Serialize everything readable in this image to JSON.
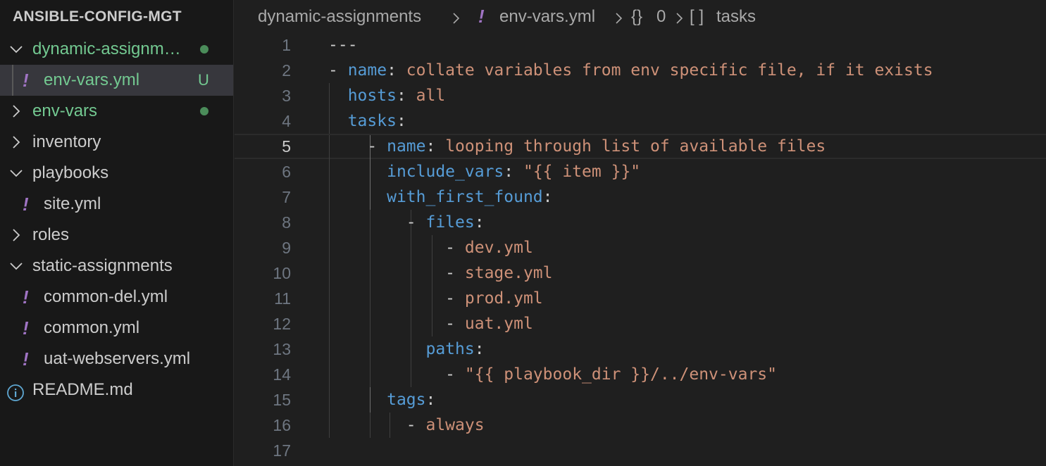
{
  "explorer": {
    "title": "ANSIBLE-CONFIG-MGT",
    "items": [
      {
        "label": "dynamic-assignments",
        "kind": "folder-open",
        "badge": "dot"
      },
      {
        "label": "env-vars.yml",
        "kind": "yaml-file",
        "badge": "U",
        "selected": true
      },
      {
        "label": "env-vars",
        "kind": "folder-closed",
        "badge": "dot"
      },
      {
        "label": "inventory",
        "kind": "folder-closed"
      },
      {
        "label": "playbooks",
        "kind": "folder-open"
      },
      {
        "label": "site.yml",
        "kind": "yaml-file"
      },
      {
        "label": "roles",
        "kind": "folder-closed"
      },
      {
        "label": "static-assignments",
        "kind": "folder-open"
      },
      {
        "label": "common-del.yml",
        "kind": "yaml-file"
      },
      {
        "label": "common.yml",
        "kind": "yaml-file"
      },
      {
        "label": "uat-webservers.yml",
        "kind": "yaml-file"
      },
      {
        "label": "README.md",
        "kind": "info-file"
      }
    ]
  },
  "breadcrumb": {
    "folder": "dynamic-assignments",
    "file_icon": "!",
    "file": "env-vars.yml",
    "obj_icon": "{}",
    "obj": "0",
    "arr_icon": "[ ]",
    "arr": "tasks"
  },
  "editor": {
    "current_line": 5,
    "lines": [
      {
        "n": "1",
        "parts": [
          [
            "punc",
            "---"
          ]
        ]
      },
      {
        "n": "2",
        "parts": [
          [
            "punc",
            "- "
          ],
          [
            "key",
            "name"
          ],
          [
            "punc",
            ": "
          ],
          [
            "str",
            "collate variables from env specific file, if it exists"
          ]
        ]
      },
      {
        "n": "3",
        "parts": [
          [
            "punc",
            "  "
          ],
          [
            "key",
            "hosts"
          ],
          [
            "punc",
            ": "
          ],
          [
            "str",
            "all"
          ]
        ]
      },
      {
        "n": "4",
        "parts": [
          [
            "punc",
            "  "
          ],
          [
            "key",
            "tasks"
          ],
          [
            "punc",
            ":"
          ]
        ]
      },
      {
        "n": "5",
        "parts": [
          [
            "punc",
            "    - "
          ],
          [
            "key",
            "name"
          ],
          [
            "punc",
            ": "
          ],
          [
            "str",
            "looping through list of available files"
          ]
        ]
      },
      {
        "n": "6",
        "parts": [
          [
            "punc",
            "      "
          ],
          [
            "key",
            "include_vars"
          ],
          [
            "punc",
            ": "
          ],
          [
            "str",
            "\"{{ item }}\""
          ]
        ]
      },
      {
        "n": "7",
        "parts": [
          [
            "punc",
            "      "
          ],
          [
            "key",
            "with_first_found"
          ],
          [
            "punc",
            ":"
          ]
        ]
      },
      {
        "n": "8",
        "parts": [
          [
            "punc",
            "        - "
          ],
          [
            "key",
            "files"
          ],
          [
            "punc",
            ":"
          ]
        ]
      },
      {
        "n": "9",
        "parts": [
          [
            "punc",
            "            - "
          ],
          [
            "str",
            "dev.yml"
          ]
        ]
      },
      {
        "n": "10",
        "parts": [
          [
            "punc",
            "            - "
          ],
          [
            "str",
            "stage.yml"
          ]
        ]
      },
      {
        "n": "11",
        "parts": [
          [
            "punc",
            "            - "
          ],
          [
            "str",
            "prod.yml"
          ]
        ]
      },
      {
        "n": "12",
        "parts": [
          [
            "punc",
            "            - "
          ],
          [
            "str",
            "uat.yml"
          ]
        ]
      },
      {
        "n": "13",
        "parts": [
          [
            "punc",
            "          "
          ],
          [
            "key",
            "paths"
          ],
          [
            "punc",
            ":"
          ]
        ]
      },
      {
        "n": "14",
        "parts": [
          [
            "punc",
            "            - "
          ],
          [
            "str",
            "\"{{ playbook_dir }}/../env-vars\""
          ]
        ]
      },
      {
        "n": "15",
        "parts": [
          [
            "punc",
            "      "
          ],
          [
            "key",
            "tags"
          ],
          [
            "punc",
            ":"
          ]
        ]
      },
      {
        "n": "16",
        "parts": [
          [
            "punc",
            "        - "
          ],
          [
            "str",
            "always"
          ]
        ]
      },
      {
        "n": "17",
        "parts": []
      }
    ]
  }
}
